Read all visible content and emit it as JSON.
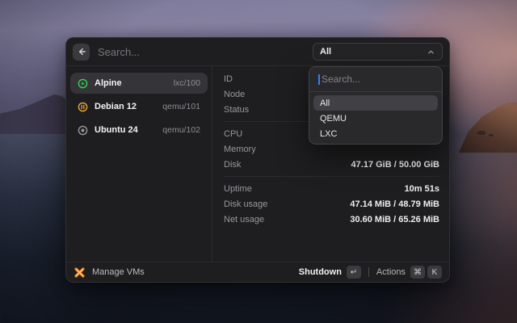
{
  "header": {
    "search_placeholder": "Search...",
    "filter": {
      "value": "All"
    }
  },
  "filter_dropdown": {
    "search_placeholder": "Search...",
    "options": [
      "All",
      "QEMU",
      "LXC"
    ],
    "selected_option": "All"
  },
  "vms": [
    {
      "name": "Alpine",
      "vmid": "lxc/100",
      "status": "running"
    },
    {
      "name": "Debian 12",
      "vmid": "qemu/101",
      "status": "paused"
    },
    {
      "name": "Ubuntu 24",
      "vmid": "qemu/102",
      "status": "stopped"
    }
  ],
  "details": {
    "rows": [
      {
        "label": "ID",
        "value": ""
      },
      {
        "label": "Node",
        "value": ""
      },
      {
        "label": "Status",
        "value": ""
      },
      {
        "label": "CPU",
        "value": ""
      },
      {
        "label": "Memory",
        "value": ""
      },
      {
        "label": "Disk",
        "value": "47.17 GiB / 50.00 GiB"
      },
      {
        "label": "Uptime",
        "value": "10m 51s"
      },
      {
        "label": "Disk usage",
        "value": "47.14 MiB / 48.79 MiB"
      },
      {
        "label": "Net usage",
        "value": "30.60 MiB / 65.26 MiB"
      }
    ]
  },
  "footer": {
    "app_label": "Manage VMs",
    "primary_action": "Shutdown",
    "primary_shortcut": "↵",
    "secondary_action": "Actions",
    "secondary_shortcut_1": "⌘",
    "secondary_shortcut_2": "K"
  },
  "colors": {
    "status_running": "#32d74b",
    "status_paused": "#f0a93a",
    "status_stopped": "#98989d",
    "proxmox_orange": "#ef7d0a",
    "caret_blue": "#3c7bf0"
  }
}
